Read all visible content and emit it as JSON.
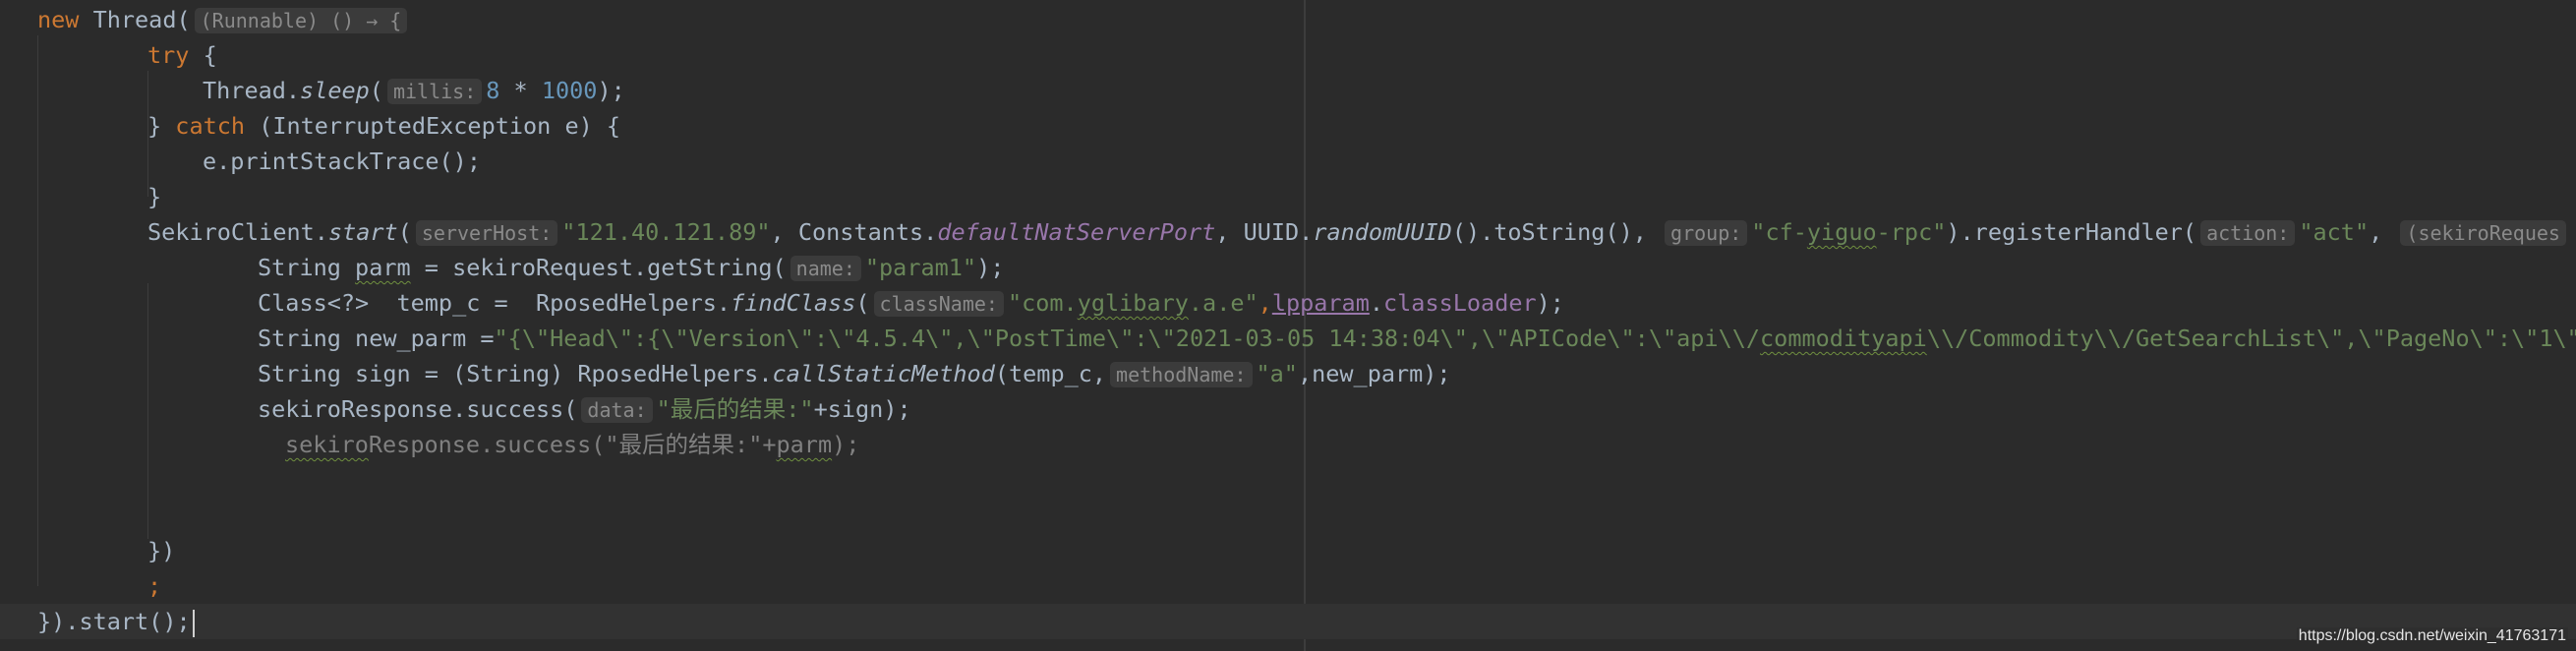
{
  "code": {
    "line1": {
      "kw_new": "new ",
      "cls_thread": "Thread(",
      "lambda_hint": "(Runnable) () → {"
    },
    "line2": {
      "kw_try": "try",
      "brace": " {"
    },
    "line3": {
      "obj": "Thread.",
      "method": "sleep",
      "open": "(",
      "hint": "millis:",
      "n1": "8",
      "op": " * ",
      "n2": "1000",
      "close": ");"
    },
    "line4": {
      "brace": "} ",
      "kw_catch": "catch",
      "rest": " (InterruptedException e) {"
    },
    "line5": {
      "text": "e.printStackTrace();"
    },
    "line6": {
      "text": "}"
    },
    "line7": {
      "obj": "SekiroClient.",
      "method": "start",
      "open": "(",
      "hint1": "serverHost:",
      "host": "\"121.40.121.89\"",
      "comma1": ", Constants.",
      "port_field": "defaultNatServerPort",
      "comma2": ", UUID.",
      "uuid_method": "randomUUID",
      "tostr": "().toString(), ",
      "hint2": "group:",
      "group_open": "\"cf-",
      "group_word": "yiguo",
      "group_close": "-rpc\"",
      "reg": ").registerHandler(",
      "hint3": "action:",
      "act": "\"act\"",
      "comma3": ", ",
      "tail": "(sekiroReques"
    },
    "line8": {
      "pre": "String ",
      "var": "parm",
      "mid": " = sekiroRequest.getString(",
      "hint": "name:",
      "str": "\"param1\"",
      "close": ");"
    },
    "line9": {
      "pre": "Class<?>  temp_c =  RposedHelpers.",
      "method": "findClass",
      "open": "(",
      "hint": "className:",
      "str_open": "\"com.",
      "str_word": "yglibary",
      "str_close": ".a.e\"",
      "comma": ",",
      "lp": "lpparam",
      "dot": ".",
      "cl": "classLoader",
      "close": ");"
    },
    "line10": {
      "pre": "String ",
      "var": "new_parm",
      "eq": " =",
      "s1": "\"{\\\"Head\\\":{\\\"Version\\\":\\\"4.5.4\\\",\\\"PostTime\\\":\\\"2021-03-05 14:38:04\\\",\\\"APICode\\\":\\\"api\\\\/",
      "s_word": "commodityapi",
      "s2": "\\\\/Commodity\\\\/GetSearchList\\\",\\\"PageNo\\\":\\\"1\\\",\\\""
    },
    "line11": {
      "pre": "String sign = (String) RposedHelpers.",
      "method": "callStaticMethod",
      "open": "(temp_c,",
      "hint": "methodName:",
      "str": "\"a\"",
      "close": ",new_parm);"
    },
    "line12": {
      "pre": "sekiroResponse.success(",
      "hint": "data:",
      "str": "\"最后的结果:\"",
      "close": "+sign);"
    },
    "line13": {
      "w1": "sekiro",
      "w1b": "Response.success(\"最后的结果:\"+",
      "w2": "parm",
      "close": ");"
    },
    "line16": {
      "text": "})"
    },
    "line17": {
      "text": ";"
    },
    "line18": {
      "text": "}).start();"
    }
  },
  "watermark": "https://blog.csdn.net/weixin_41763171"
}
